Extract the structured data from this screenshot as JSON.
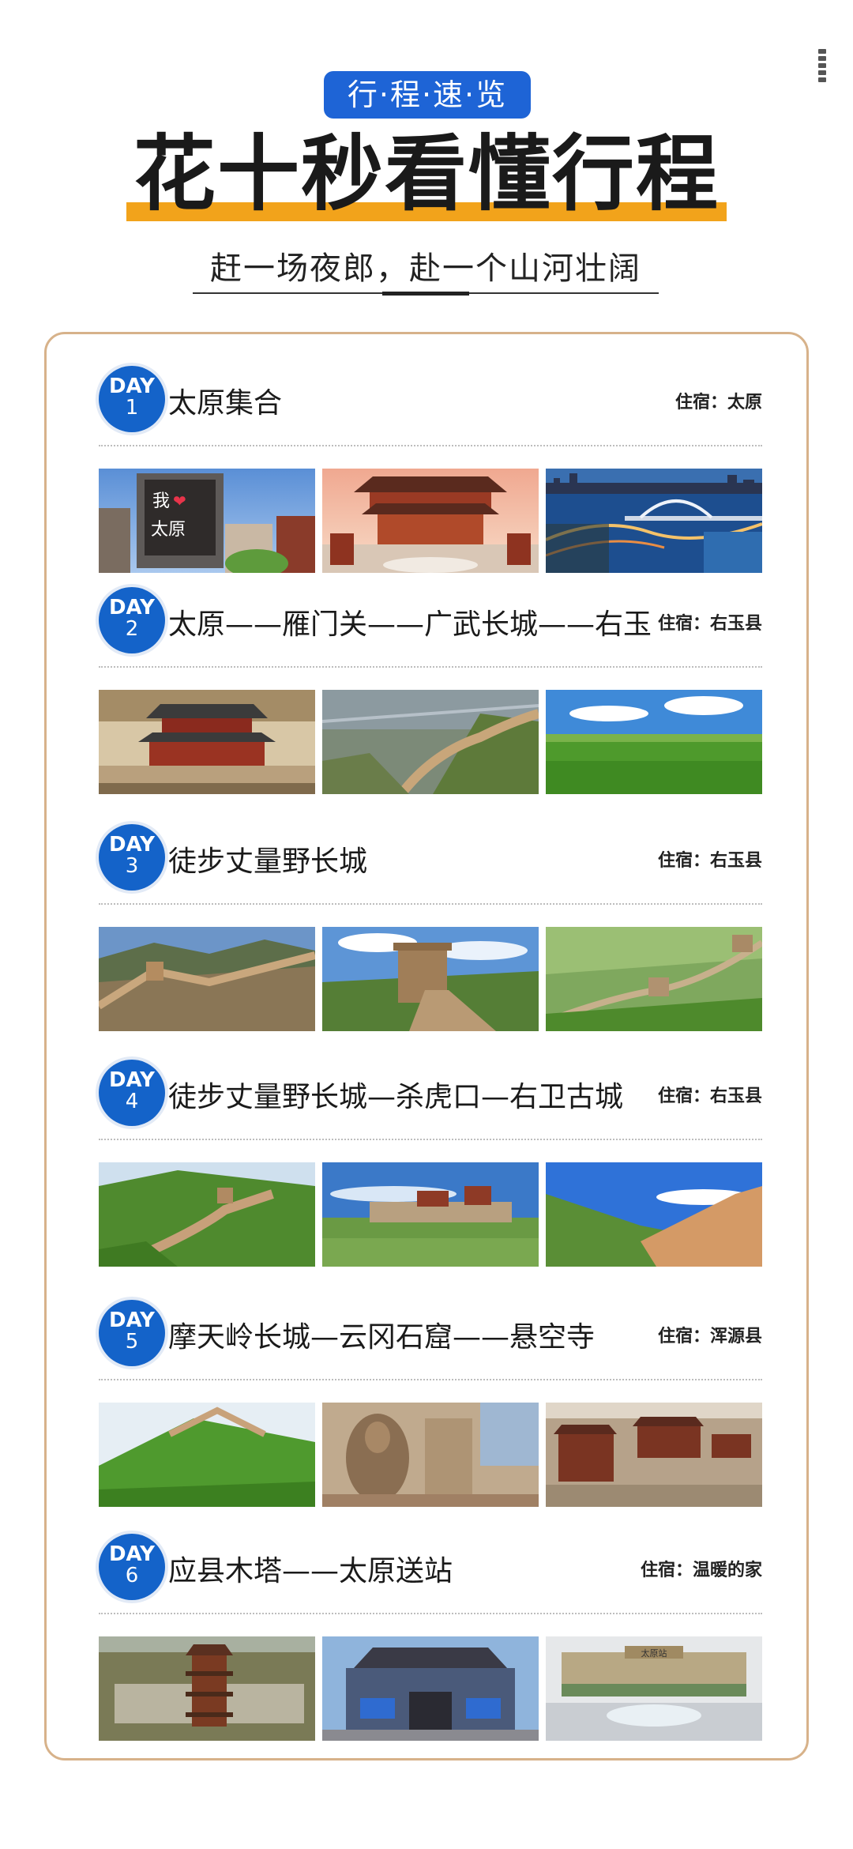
{
  "header": {
    "badge": "行·程·速·览",
    "title": "花十秒看懂行程",
    "subtitle": "赶一场夜郎，赴一个山河壮阔"
  },
  "days": [
    {
      "badge_label": "DAY",
      "number": "1",
      "title": "太原集合",
      "stay": "住宿：太原",
      "photos": [
        {
          "name": "taiyuan-sign-photo",
          "sign_top": "我",
          "sign_bottom": "太原",
          "heart": "❤"
        },
        {
          "name": "temple-gate-photo"
        },
        {
          "name": "night-bridge-photo"
        }
      ]
    },
    {
      "badge_label": "DAY",
      "number": "2",
      "title": "太原——雁门关——广武长城——右玉",
      "stay": "住宿：右玉县",
      "photos": [
        {
          "name": "yanmen-pass-photo"
        },
        {
          "name": "guangwu-great-wall-photo"
        },
        {
          "name": "grassland-photo"
        }
      ]
    },
    {
      "badge_label": "DAY",
      "number": "3",
      "title": "徒步丈量野长城",
      "stay": "住宿：右玉县",
      "photos": [
        {
          "name": "wild-wall-ridge-photo"
        },
        {
          "name": "watchtower-photo"
        },
        {
          "name": "green-hills-wall-photo"
        }
      ]
    },
    {
      "badge_label": "DAY",
      "number": "4",
      "title": "徒步丈量野长城—杀虎口—右卫古城",
      "stay": "住宿：右玉县",
      "photos": [
        {
          "name": "wall-on-hills-photo"
        },
        {
          "name": "youwei-ancient-city-photo"
        },
        {
          "name": "loess-hills-photo"
        }
      ]
    },
    {
      "badge_label": "DAY",
      "number": "5",
      "title": "摩天岭长城—云冈石窟——悬空寺",
      "stay": "住宿：浑源县",
      "photos": [
        {
          "name": "motianling-wall-photo"
        },
        {
          "name": "yungang-grottoes-photo"
        },
        {
          "name": "hanging-temple-photo"
        }
      ]
    },
    {
      "badge_label": "DAY",
      "number": "6",
      "title": "应县木塔——太原送站",
      "stay": "住宿：温暖的家",
      "photos": [
        {
          "name": "wooden-pagoda-photo"
        },
        {
          "name": "temple-arch-photo"
        },
        {
          "name": "taiyuan-station-photo",
          "station_label": "太原站"
        }
      ]
    }
  ],
  "colors": {
    "accent_blue": "#1463c9",
    "title_underline": "#f2a31b",
    "card_border": "#d7b28a"
  }
}
